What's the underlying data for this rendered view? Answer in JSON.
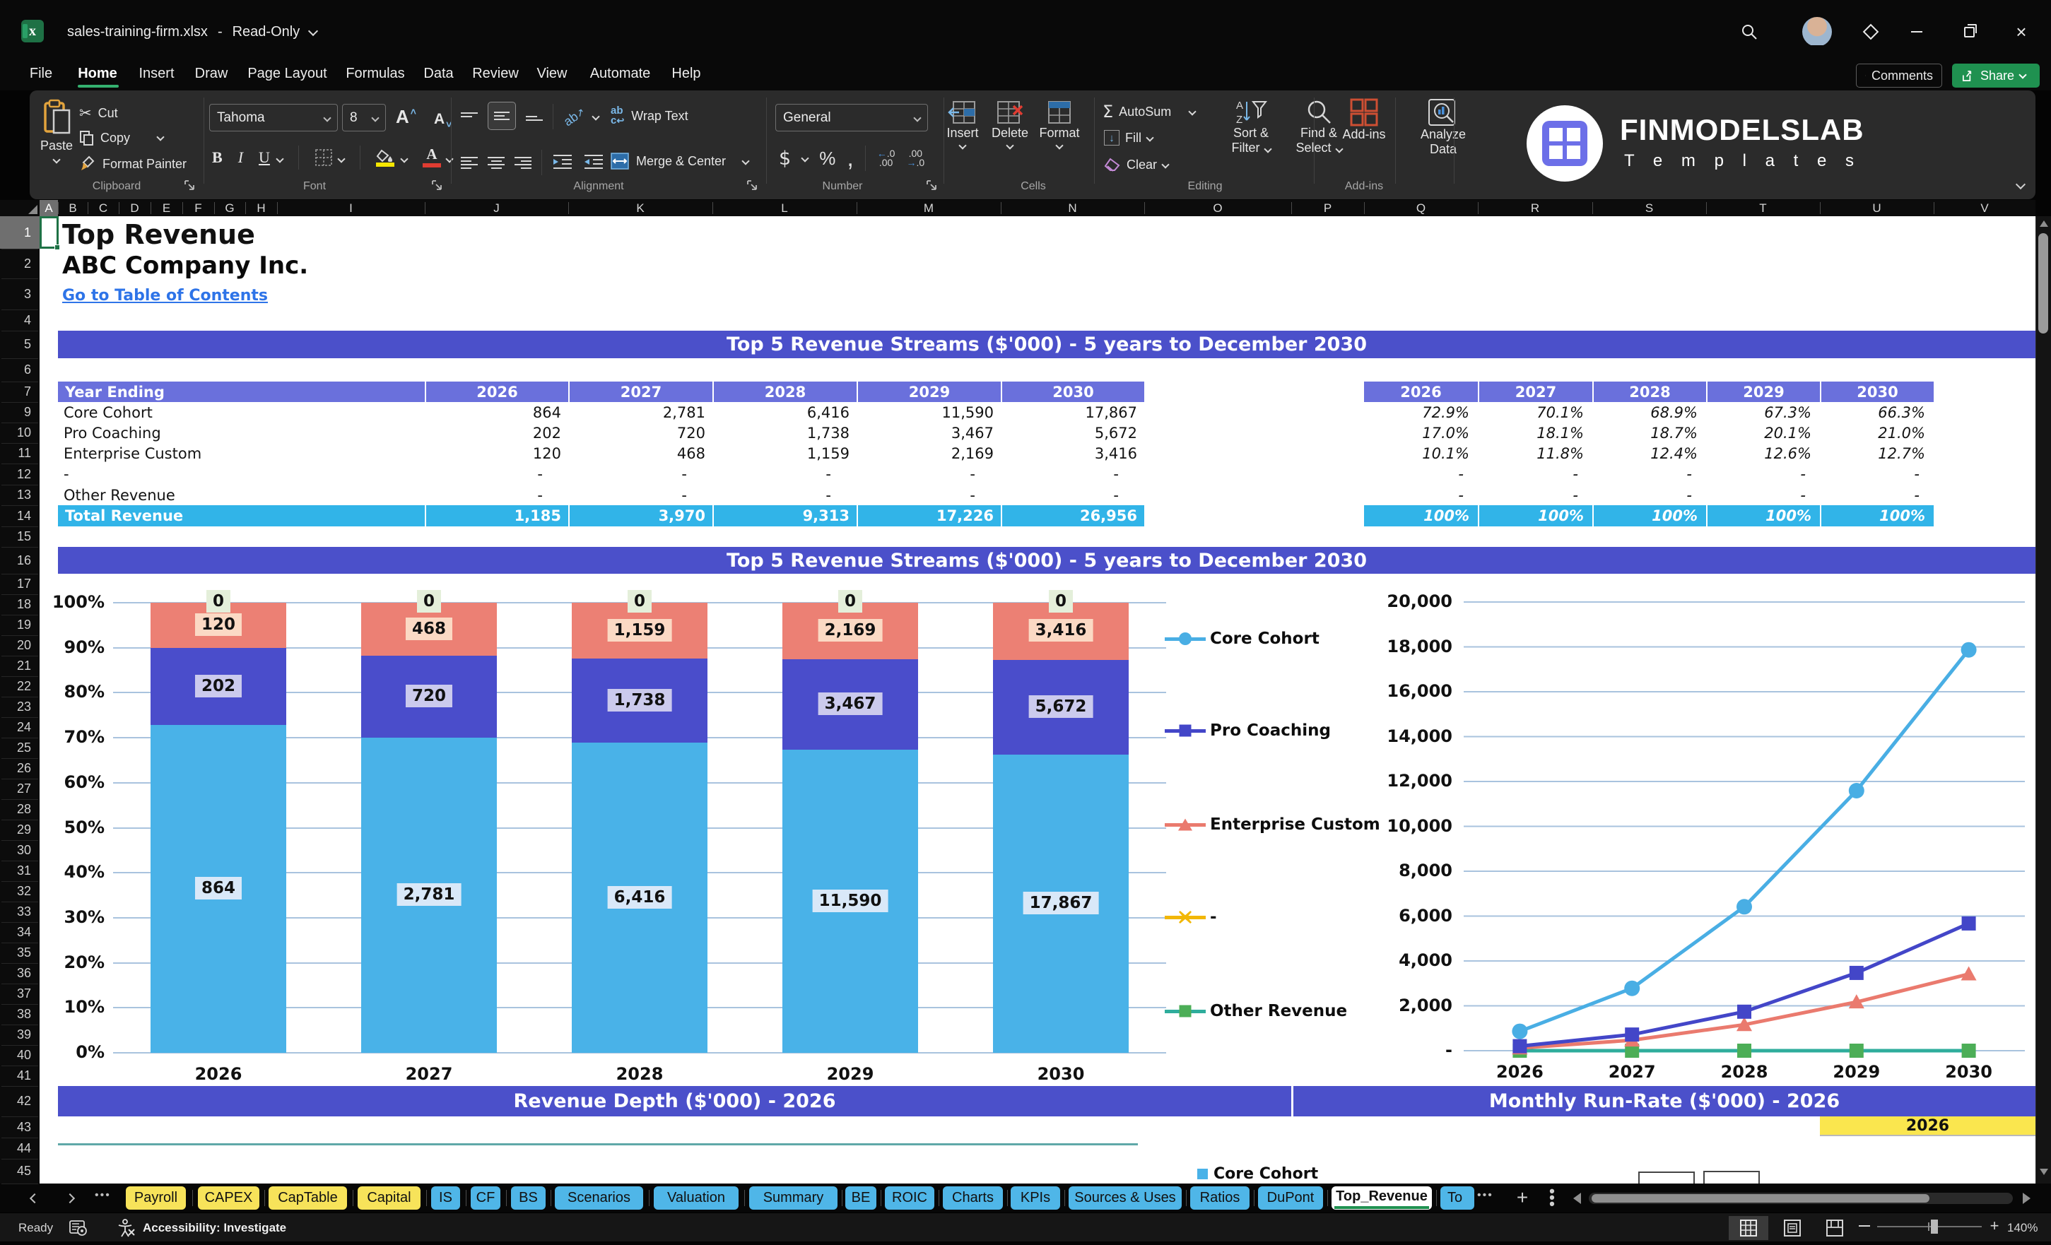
{
  "window": {
    "file_name": "sales-training-firm.xlsx",
    "separator": "-",
    "mode": "Read-Only",
    "comments": "Comments",
    "share": "Share"
  },
  "menu": {
    "items": [
      "File",
      "Home",
      "Insert",
      "Draw",
      "Page Layout",
      "Formulas",
      "Data",
      "Review",
      "View",
      "Automate",
      "Help"
    ],
    "active": "Home"
  },
  "ribbon": {
    "paste": "Paste",
    "cut": "Cut",
    "copy": "Copy",
    "format_painter": "Format Painter",
    "clipboard_group": "Clipboard",
    "font_name": "Tahoma",
    "font_size": "8",
    "font_group": "Font",
    "wrap_text": "Wrap Text",
    "merge_center": "Merge & Center",
    "alignment_group": "Alignment",
    "number_format": "General",
    "number_group": "Number",
    "insert": "Insert",
    "delete": "Delete",
    "format": "Format",
    "cells_group": "Cells",
    "autosum": "AutoSum",
    "fill": "Fill",
    "clear": "Clear",
    "sort_line1": "Sort &",
    "sort_line2": "Filter",
    "find_line1": "Find &",
    "find_line2": "Select",
    "editing_group": "Editing",
    "addins": "Add-ins",
    "addins_group": "Add-ins",
    "analyze_line1": "Analyze",
    "analyze_line2": "Data",
    "brand": "FINMODELSLAB",
    "brand_sub": "T e m p l a t e s"
  },
  "sheet": {
    "columns": [
      "A",
      "B",
      "C",
      "D",
      "E",
      "F",
      "G",
      "H",
      "I",
      "J",
      "K",
      "L",
      "M",
      "N",
      "O",
      "P",
      "Q",
      "R",
      "S",
      "T",
      "U",
      "V"
    ],
    "rows": [
      1,
      2,
      3,
      4,
      5,
      6,
      7,
      9,
      10,
      11,
      12,
      13,
      14,
      15,
      16,
      17,
      18,
      19,
      20,
      21,
      22,
      23,
      24,
      25,
      26,
      27,
      28,
      29,
      30,
      31,
      32,
      33,
      34,
      35,
      36,
      37,
      38,
      39,
      40,
      41,
      42,
      43,
      44,
      45
    ],
    "title": "Top Revenue",
    "company": "ABC Company Inc.",
    "toc_link": "Go to Table of Contents",
    "section1_title": "Top 5 Revenue Streams ($'000) - 5 years to December 2030",
    "section2_title": "Top 5 Revenue Streams ($'000) - 5 years to December 2030",
    "section3_title": "Revenue Depth ($'000) - 2026",
    "section4_title": "Monthly Run-Rate ($'000) - 2026",
    "runrate_year": "2026",
    "partial_legend": "Core Cohort",
    "main_table": {
      "header": "Year Ending",
      "years": [
        "2026",
        "2027",
        "2028",
        "2029",
        "2030"
      ],
      "rows": [
        {
          "label": "Core Cohort",
          "values": [
            "864",
            "2,781",
            "6,416",
            "11,590",
            "17,867"
          ]
        },
        {
          "label": "Pro Coaching",
          "values": [
            "202",
            "720",
            "1,738",
            "3,467",
            "5,672"
          ]
        },
        {
          "label": "Enterprise Custom",
          "values": [
            "120",
            "468",
            "1,159",
            "2,169",
            "3,416"
          ]
        },
        {
          "label": "-",
          "values": [
            "-",
            "-",
            "-",
            "-",
            "-"
          ]
        },
        {
          "label": "Other Revenue",
          "values": [
            "-",
            "-",
            "-",
            "-",
            "-"
          ]
        }
      ],
      "total_label": "Total Revenue",
      "total_values": [
        "1,185",
        "3,970",
        "9,313",
        "17,226",
        "26,956"
      ]
    },
    "pct_table": {
      "years": [
        "2026",
        "2027",
        "2028",
        "2029",
        "2030"
      ],
      "rows": [
        [
          "72.9%",
          "70.1%",
          "68.9%",
          "67.3%",
          "66.3%"
        ],
        [
          "17.0%",
          "18.1%",
          "18.7%",
          "20.1%",
          "21.0%"
        ],
        [
          "10.1%",
          "11.8%",
          "12.4%",
          "12.6%",
          "12.7%"
        ],
        [
          "-",
          "-",
          "-",
          "-",
          "-"
        ],
        [
          "-",
          "-",
          "-",
          "-",
          "-"
        ]
      ],
      "total_values": [
        "100%",
        "100%",
        "100%",
        "100%",
        "100%"
      ]
    }
  },
  "chart_data": [
    {
      "type": "bar",
      "subtype": "stacked-100-percent",
      "title": "Top 5 Revenue Streams ($'000) - 5 years to December 2030",
      "categories": [
        "2026",
        "2027",
        "2028",
        "2029",
        "2030"
      ],
      "series": [
        {
          "name": "Core Cohort",
          "color": "#49b2e8",
          "label_bg": "#d9e8f8",
          "values": [
            864,
            2781,
            6416,
            11590,
            17867
          ],
          "labels": [
            "864",
            "2,781",
            "6,416",
            "11,590",
            "17,867"
          ]
        },
        {
          "name": "Pro Coaching",
          "color": "#4a4dcb",
          "label_bg": "#cbcaed",
          "values": [
            202,
            720,
            1738,
            3467,
            5672
          ],
          "labels": [
            "202",
            "720",
            "1,738",
            "3,467",
            "5,672"
          ]
        },
        {
          "name": "Enterprise Custom",
          "color": "#ec8074",
          "label_bg": "#fbd9c4",
          "values": [
            120,
            468,
            1159,
            2169,
            3416
          ],
          "labels": [
            "120",
            "468",
            "1,159",
            "2,169",
            "3,416"
          ]
        }
      ],
      "zero_labels": {
        "texts": [
          "0",
          "0",
          "0",
          "0",
          "0"
        ],
        "bg": "#e4efda"
      },
      "y_ticks": [
        "100%",
        "90%",
        "80%",
        "70%",
        "60%",
        "50%",
        "40%",
        "30%",
        "20%",
        "10%",
        "0%"
      ],
      "ylim": [
        0,
        100
      ],
      "xlabel": "",
      "ylabel": "",
      "grid": true,
      "legend_position": "none"
    },
    {
      "type": "line",
      "title": "Top 5 Revenue Streams ($'000) - 5 years to December 2030",
      "categories": [
        "2026",
        "2027",
        "2028",
        "2029",
        "2030"
      ],
      "series": [
        {
          "name": "Core Cohort",
          "color": "#49aee4",
          "marker": "circle",
          "values": [
            864,
            2781,
            6416,
            11590,
            17867
          ]
        },
        {
          "name": "Pro Coaching",
          "color": "#4346c8",
          "marker": "square",
          "values": [
            202,
            720,
            1738,
            3467,
            5672
          ]
        },
        {
          "name": "Enterprise Custom",
          "color": "#ea7a6e",
          "marker": "triangle",
          "values": [
            120,
            468,
            1159,
            2169,
            3416
          ]
        },
        {
          "name": "-",
          "color": "#f2b705",
          "marker": "x",
          "values": [
            0,
            0,
            0,
            0,
            0
          ]
        },
        {
          "name": "Other Revenue",
          "color": "#2fad9c",
          "marker": "square",
          "marker_color": "#4cae57",
          "values": [
            0,
            0,
            0,
            0,
            0
          ]
        }
      ],
      "y_ticks": [
        "20,000",
        "18,000",
        "16,000",
        "14,000",
        "12,000",
        "10,000",
        "8,000",
        "6,000",
        "4,000",
        "2,000",
        "-"
      ],
      "ylim": [
        0,
        20000
      ],
      "xlabel": "",
      "ylabel": "",
      "grid": true,
      "legend_position": "left"
    }
  ],
  "tabs": {
    "nav_back": "previous-sheet",
    "nav_fwd": "next-sheet",
    "items": [
      {
        "label": "Payroll",
        "color": "yellow"
      },
      {
        "label": "CAPEX",
        "color": "yellow"
      },
      {
        "label": "CapTable",
        "color": "yellow"
      },
      {
        "label": "Capital",
        "color": "yellow"
      },
      {
        "label": "IS",
        "color": "blue"
      },
      {
        "label": "CF",
        "color": "blue"
      },
      {
        "label": "BS",
        "color": "blue"
      },
      {
        "label": "Scenarios",
        "color": "blue"
      },
      {
        "label": "Valuation",
        "color": "blue"
      },
      {
        "label": "Summary",
        "color": "blue"
      },
      {
        "label": "BE",
        "color": "blue"
      },
      {
        "label": "ROIC",
        "color": "blue"
      },
      {
        "label": "Charts",
        "color": "blue"
      },
      {
        "label": "KPIs",
        "color": "blue"
      },
      {
        "label": "Sources & Uses",
        "color": "blue"
      },
      {
        "label": "Ratios",
        "color": "blue"
      },
      {
        "label": "DuPont",
        "color": "blue"
      },
      {
        "label": "Top_Revenue",
        "color": "white",
        "active": true
      },
      {
        "label": "To",
        "color": "blue",
        "clipped": true
      }
    ]
  },
  "status": {
    "ready": "Ready",
    "accessibility": "Accessibility: Investigate",
    "zoom": "140%"
  },
  "colors": {
    "banner": "#4b50ca",
    "table_header": "#6a70dc",
    "total_row": "#31b4e8",
    "hyperlink": "#2e74e8",
    "selection_green": "#1e7145",
    "tab_yellow": "#f7e35a",
    "tab_blue": "#4fb6e8",
    "share_green": "#1f9150",
    "chart_grid": "#a9c3de",
    "runrate_cell_yellow": "#fae64e"
  }
}
